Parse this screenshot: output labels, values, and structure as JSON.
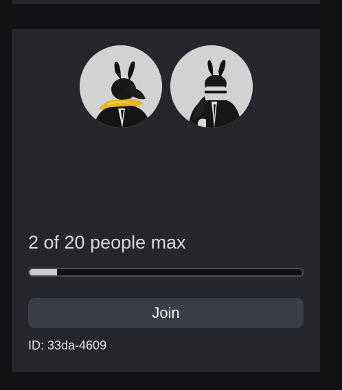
{
  "server": {
    "player_count_text": "2 of 20 people max",
    "players_current": 2,
    "players_max": 20,
    "join_label": "Join",
    "id_text": "ID: 33da-4609"
  },
  "avatars": [
    {
      "name": "player-avatar-1"
    },
    {
      "name": "player-avatar-2"
    }
  ],
  "colors": {
    "background": "#121215",
    "card": "#24262c",
    "button": "#3b3d46",
    "progress_fill": "#c9cbd0",
    "avatar_bg": "#d2d2d2"
  }
}
